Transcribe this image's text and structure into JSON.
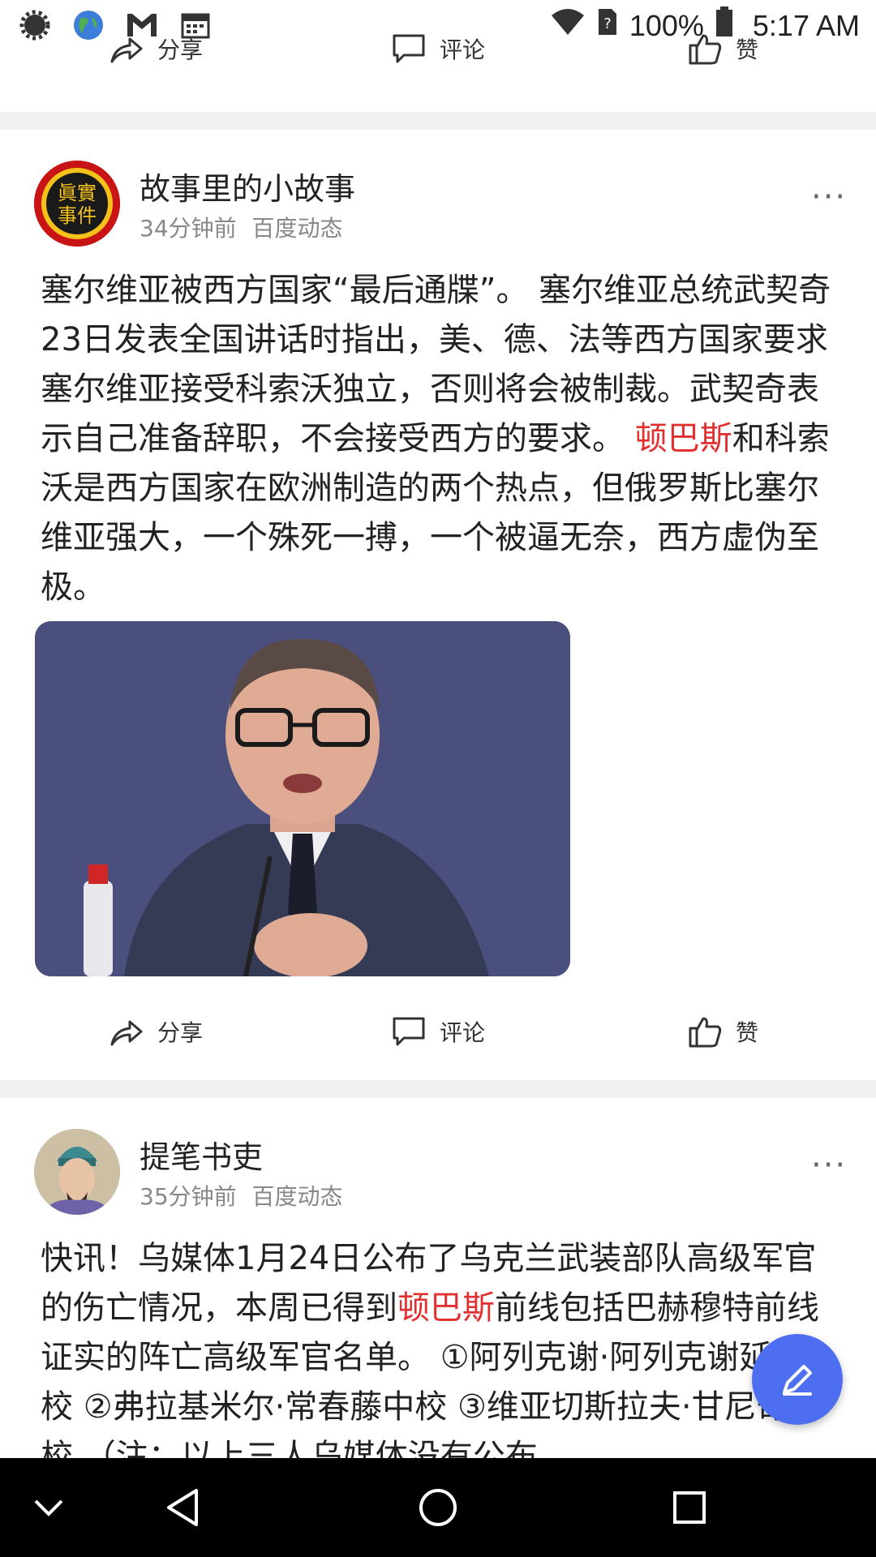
{
  "status_bar": {
    "battery": "100%",
    "time": "5:17 AM",
    "icons": [
      "settings-gear-icon",
      "globe-icon",
      "gmail-icon",
      "calendar-icon",
      "wifi-icon",
      "sim-unknown-icon",
      "battery-icon"
    ]
  },
  "actions": {
    "share": "分享",
    "comment": "评论",
    "like": "赞"
  },
  "posts": [
    {
      "author": "故事里的小故事",
      "time": "34分钟前",
      "source": "百度动态",
      "avatar_text": "眞實事件",
      "text_before": "塞尔维亚被西方国家“最后通牒”。 塞尔维亚总统武契奇23日发表全国讲话时指出，美、德、法等西方国家要求塞尔维亚接受科索沃独立，否则将会被制裁。武契奇表示自己准备辞职，不会接受西方的要求。 ",
      "highlight": "顿巴斯",
      "text_after": "和科索沃是西方国家在欧洲制造的两个热点，但俄罗斯比塞尔维亚强大，一个殊死一搏，一个被逼无奈，西方虚伪至极。"
    },
    {
      "author": "提笔书吏",
      "time": "35分钟前",
      "source": "百度动态",
      "text_before": "快讯！乌媒体1月24日公布了乌克兰武装部队高级军官的伤亡情况，本周已得到",
      "highlight": "顿巴斯",
      "text_after": "前线包括巴赫穆特前线证实的阵亡高级军官名单。 ①阿列克谢·阿列克谢延科上校 ②弗拉基米尔·常春藤中校 ③维亚切斯拉夫·甘尼奇中校 （注：以上三人乌媒体没有公布"
    }
  ],
  "more_label": "···",
  "colors": {
    "highlight": "#e03030",
    "fab": "#4e6ef2",
    "separator": "#f1f1f1"
  }
}
